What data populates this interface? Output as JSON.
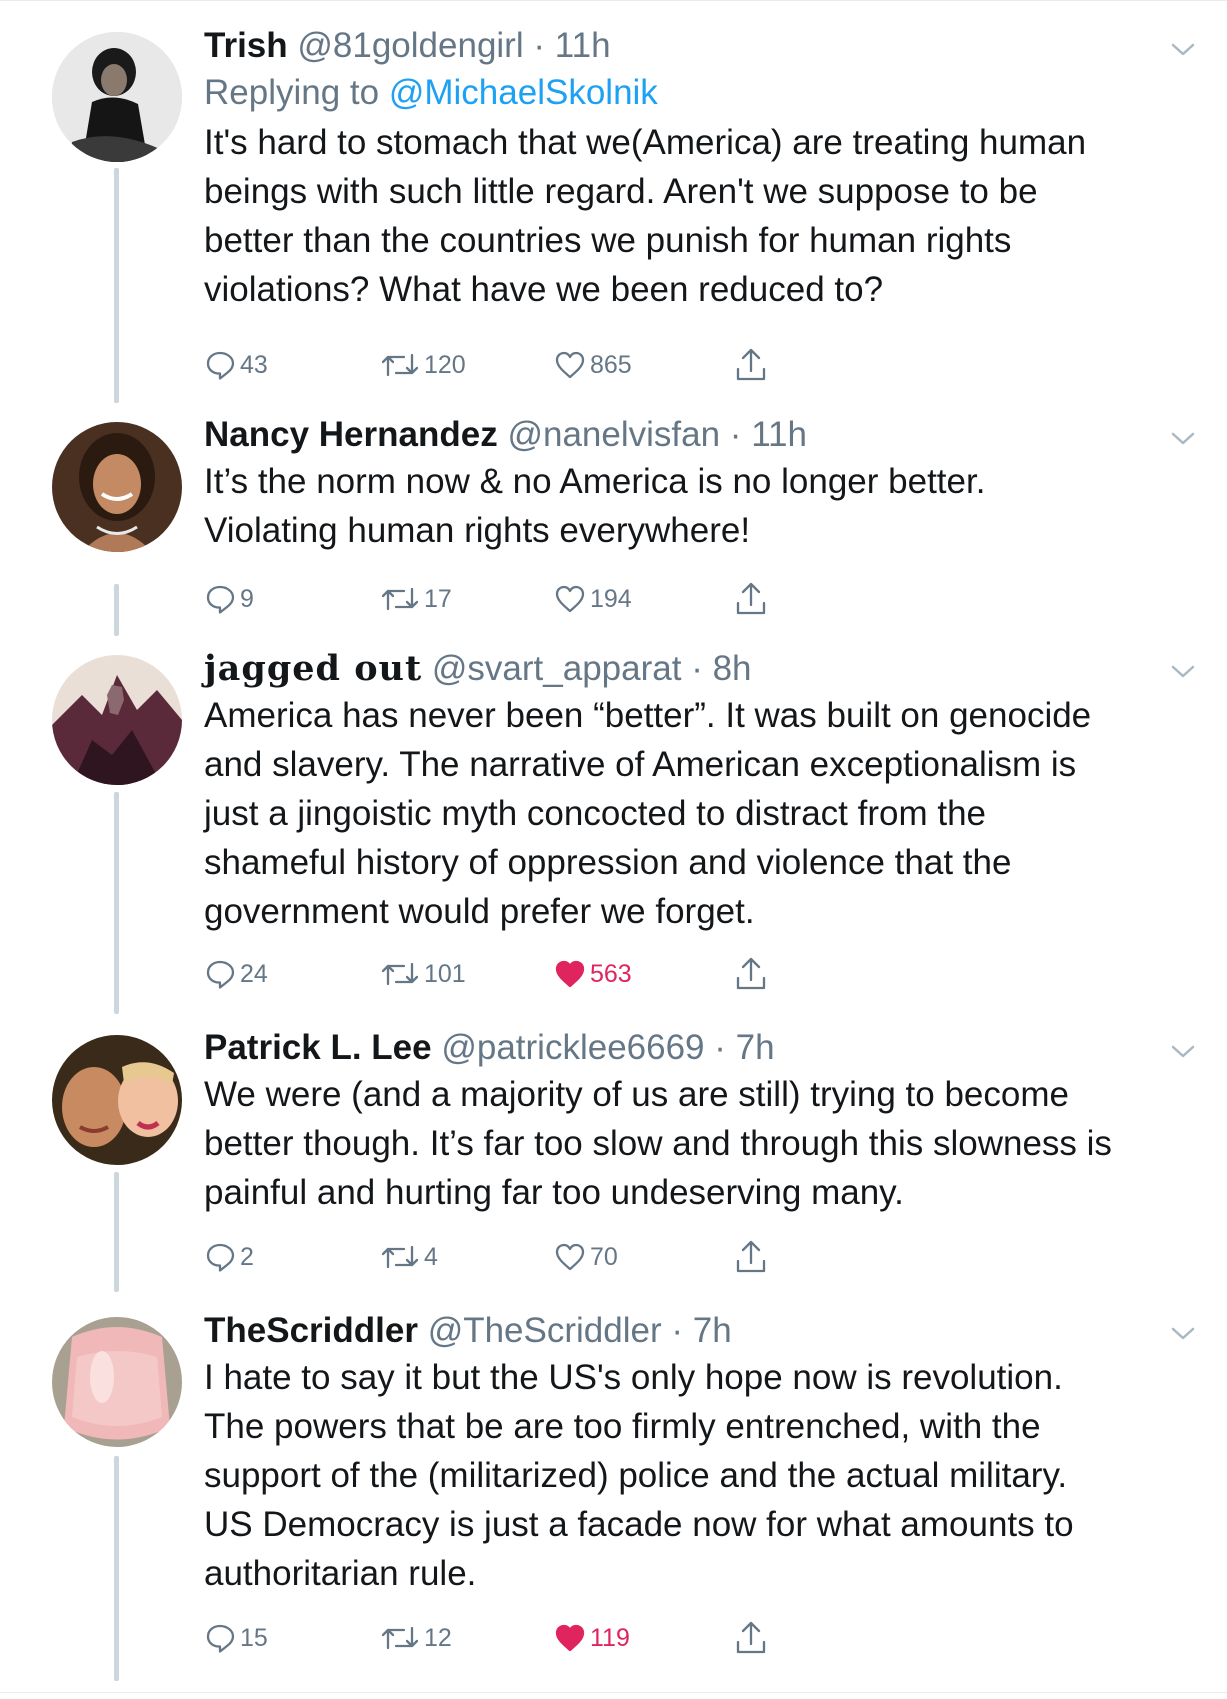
{
  "tweets": [
    {
      "name": "Trish",
      "handle": "@81goldengirl",
      "dot": "·",
      "time": "11h",
      "replying_prefix": "Replying to",
      "replying_to": "@MichaelSkolnik",
      "text": "It's hard to stomach that we(America) are treating human\nbeings with such little regard. Aren't we suppose to be\nbetter than the countries we punish for human rights\nviolations? What have we been reduced to?",
      "replies": "43",
      "retweets": "120",
      "likes": "865",
      "liked": false
    },
    {
      "name": "Nancy Hernandez",
      "handle": "@nanelvisfan",
      "dot": "·",
      "time": "11h",
      "text": "It’s the norm now & no America is no longer better.\nViolating human rights everywhere!",
      "replies": "9",
      "retweets": "17",
      "likes": "194",
      "liked": false
    },
    {
      "name": "jagged out",
      "handle": "@svart_apparat",
      "dot": "·",
      "time": "8h",
      "text": "America has never been “better”. It was built on genocide\nand slavery. The narrative of American exceptionalism is\njust a jingoistic myth concocted to distract from the\nshameful history of oppression and violence that the\ngovernment would prefer we forget.",
      "replies": "24",
      "retweets": "101",
      "likes": "563",
      "liked": true
    },
    {
      "name": "Patrick L. Lee",
      "handle": "@patricklee6669",
      "dot": "·",
      "time": "7h",
      "text": "We were (and a majority of us are still) trying to become\nbetter though. It’s far too slow and through this slowness is\npainful and hurting far too undeserving many.",
      "replies": "2",
      "retweets": "4",
      "likes": "70",
      "liked": false
    },
    {
      "name": "TheScriddler",
      "handle": "@TheScriddler",
      "dot": "·",
      "time": "7h",
      "text": "I hate to say it but the US's only hope now is revolution.\nThe powers that be are too firmly entrenched, with the\nsupport of the (militarized) police and the actual military.\nUS Democracy is just a facade now for what amounts to\nauthoritarian rule.",
      "replies": "15",
      "retweets": "12",
      "likes": "119",
      "liked": true
    }
  ],
  "colors": {
    "text": "#14171a",
    "secondary": "#657786",
    "link": "#1da1f2",
    "like_active": "#e0245e",
    "thread_line": "#ccd6dd"
  },
  "icons": [
    "reply-icon",
    "retweet-icon",
    "like-icon",
    "share-icon",
    "chevron-down-icon"
  ]
}
